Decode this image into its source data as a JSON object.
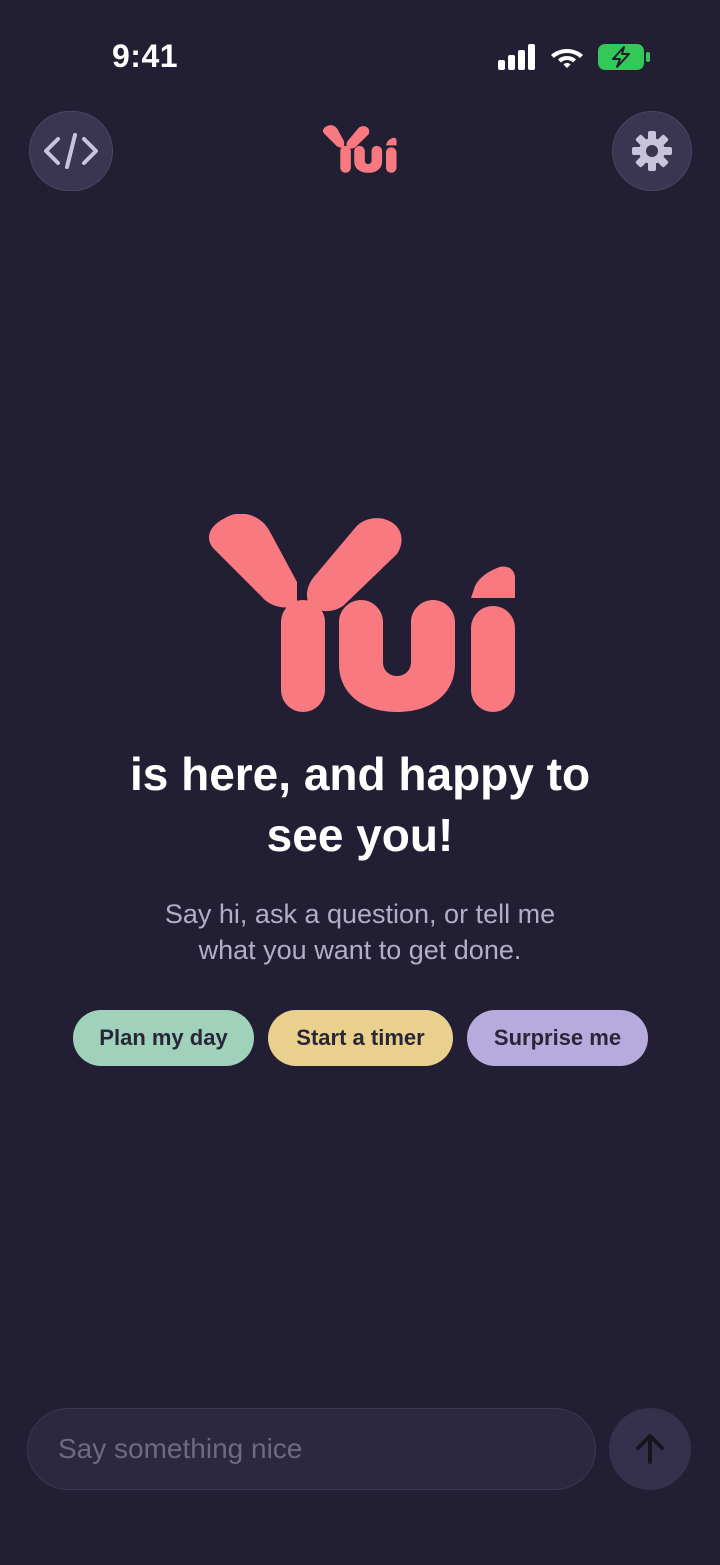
{
  "status_bar": {
    "time": "9:41",
    "icons": [
      "cellular-signal-icon",
      "wifi-icon",
      "battery-charging-icon"
    ],
    "battery_color": "#34c759"
  },
  "header": {
    "left_icon": "code-icon",
    "right_icon": "gear-icon",
    "logo_text": "Yui"
  },
  "hero": {
    "logo_text": "Yui",
    "headline_line1": "is here, and happy to",
    "headline_line2": "see you!",
    "subtitle_line1": "Say hi, ask a question, or tell me",
    "subtitle_line2": "what you want to get done."
  },
  "chips": [
    {
      "label": "Plan my day",
      "color": "#9fd1bb"
    },
    {
      "label": "Start a timer",
      "color": "#e9d18d"
    },
    {
      "label": "Surprise me",
      "color": "#b7aadc"
    }
  ],
  "composer": {
    "placeholder": "Say something nice",
    "value": "",
    "send_icon": "arrow-up-icon"
  },
  "colors": {
    "background": "#221e34",
    "brand": "#f87a80",
    "button_bg": "#3a3550",
    "muted_text": "#b3aec7"
  }
}
